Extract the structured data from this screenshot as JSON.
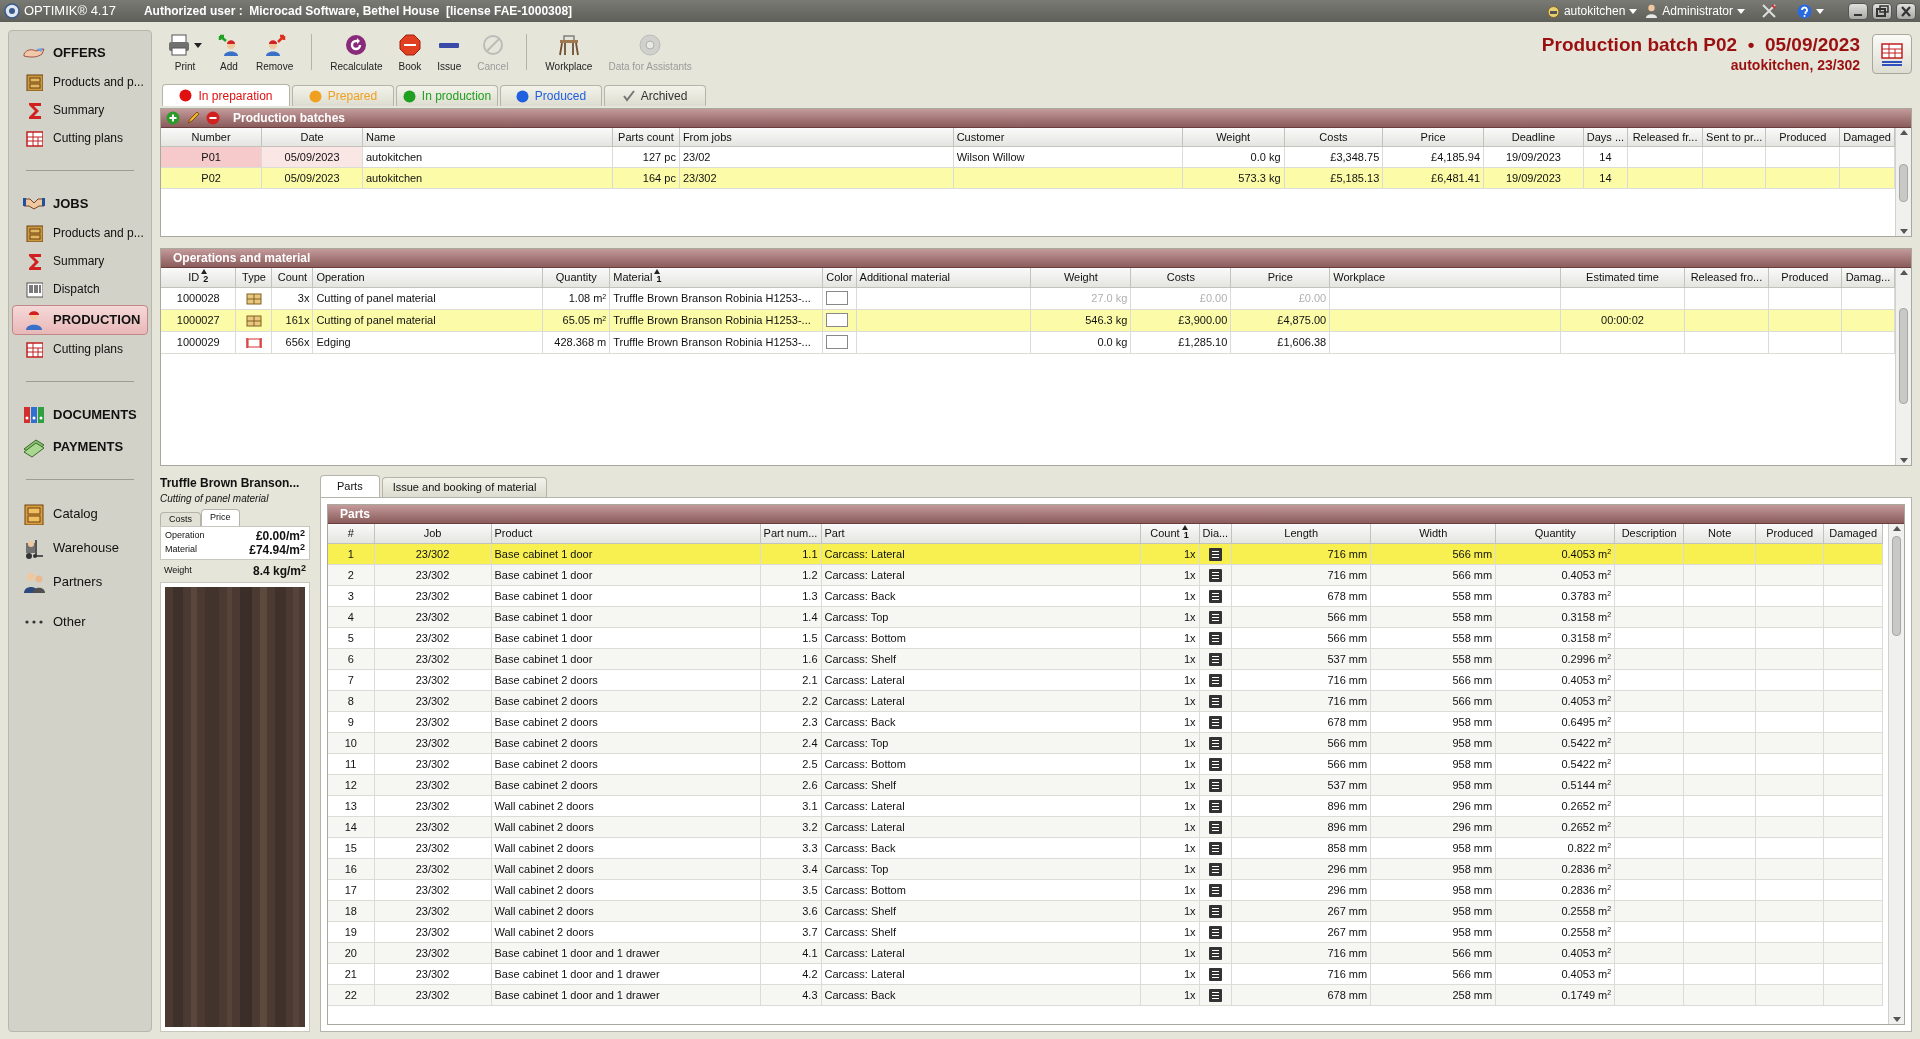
{
  "title_bar": {
    "app": "OPTIMIK® 4.17",
    "authorized": "Authorized user :  Microcad Software, Bethel House  [license FAE-1000308]",
    "company": "autokitchen",
    "user": "Administrator"
  },
  "sidebar": {
    "groups": [
      [
        {
          "label": "OFFERS",
          "kind": "section",
          "selected": false
        },
        {
          "label": "Products and p...",
          "kind": "item",
          "selected": false
        },
        {
          "label": "Summary",
          "kind": "item",
          "selected": false
        },
        {
          "label": "Cutting plans",
          "kind": "item",
          "selected": false
        }
      ],
      [
        {
          "label": "JOBS",
          "kind": "section",
          "selected": false
        },
        {
          "label": "Products and p...",
          "kind": "item",
          "selected": false
        },
        {
          "label": "Summary",
          "kind": "item",
          "selected": false
        },
        {
          "label": "Dispatch",
          "kind": "item",
          "selected": false
        },
        {
          "label": "PRODUCTION",
          "kind": "section",
          "selected": true
        },
        {
          "label": "Cutting plans",
          "kind": "item",
          "selected": false
        }
      ],
      [
        {
          "label": "DOCUMENTS",
          "kind": "section",
          "selected": false
        },
        {
          "label": "PAYMENTS",
          "kind": "section",
          "selected": false
        }
      ],
      [
        {
          "label": "Catalog",
          "kind": "tool",
          "selected": false
        },
        {
          "label": "Warehouse",
          "kind": "tool",
          "selected": false
        },
        {
          "label": "Partners",
          "kind": "tool",
          "selected": false
        },
        {
          "label": "Other",
          "kind": "tool",
          "selected": false
        }
      ]
    ]
  },
  "toolbar": [
    [
      {
        "label": "Print",
        "disabled": false
      },
      {
        "label": "Add",
        "disabled": false
      },
      {
        "label": "Remove",
        "disabled": false
      }
    ],
    [
      {
        "label": "Recalculate",
        "disabled": false
      },
      {
        "label": "Book",
        "disabled": false
      },
      {
        "label": "Issue",
        "disabled": false
      },
      {
        "label": "Cancel",
        "disabled": true
      }
    ],
    [
      {
        "label": "Workplace",
        "disabled": false
      },
      {
        "label": "Data for Assistants",
        "disabled": true
      }
    ]
  ],
  "status_tabs": [
    {
      "label": "In preparation",
      "kind": "dot",
      "color": "#e01010",
      "selected": true
    },
    {
      "label": "Prepared",
      "kind": "dot",
      "color": "#f0a020",
      "selected": false
    },
    {
      "label": "In production",
      "kind": "dot",
      "color": "#20a020",
      "selected": false
    },
    {
      "label": "Produced",
      "kind": "dot",
      "color": "#2060e0",
      "selected": false
    },
    {
      "label": "Archived",
      "kind": "check",
      "color": "#333333",
      "selected": false
    }
  ],
  "header": {
    "title": "Production batch P02  •  05/09/2023",
    "subtitle": "autokitchen, 23/302"
  },
  "batches": {
    "title": "Production batches",
    "columns": [
      {
        "label": "Number"
      },
      {
        "label": "Date"
      },
      {
        "label": "Name"
      },
      {
        "label": "Parts count"
      },
      {
        "label": "From jobs"
      },
      {
        "label": "Customer"
      },
      {
        "label": "Weight"
      },
      {
        "label": "Costs"
      },
      {
        "label": "Price"
      },
      {
        "label": "Deadline"
      },
      {
        "label": "Days ..."
      },
      {
        "label": "Released fr..."
      },
      {
        "label": "Sent to pr..."
      },
      {
        "label": "Produced"
      },
      {
        "label": "Damaged"
      }
    ],
    "rows": [
      {
        "selected": false,
        "marked": true,
        "cells": [
          "P01",
          "05/09/2023",
          "autokitchen",
          "127 pc",
          "23/02",
          "Wilson Willow",
          "0.0 kg",
          "£3,348.75",
          "£4,185.94",
          "19/09/2023",
          "14"
        ]
      },
      {
        "selected": true,
        "marked": false,
        "cells": [
          "P02",
          "05/09/2023",
          "autokitchen",
          "164 pc",
          "23/302",
          "",
          "573.3 kg",
          "£5,185.13",
          "£6,481.41",
          "19/09/2023",
          "14"
        ]
      }
    ]
  },
  "operations": {
    "title": "Operations and material",
    "columns": [
      {
        "label": "ID",
        "sort": "2"
      },
      {
        "label": "Type"
      },
      {
        "label": "Count"
      },
      {
        "label": "Operation"
      },
      {
        "label": "Quantity"
      },
      {
        "label": "Material",
        "sort": "1"
      },
      {
        "label": "Color"
      },
      {
        "label": "Additional material"
      },
      {
        "label": "Weight"
      },
      {
        "label": "Costs"
      },
      {
        "label": "Price"
      },
      {
        "label": "Workplace"
      },
      {
        "label": "Estimated time"
      },
      {
        "label": "Released fro..."
      },
      {
        "label": "Produced"
      },
      {
        "label": "Damag..."
      }
    ],
    "rows": [
      {
        "selected": false,
        "dimmed": true,
        "kind": "panel",
        "cells": [
          "1000028",
          "",
          "3x",
          "Cutting of panel material",
          "1.08 m$^{2}$",
          "Truffle Brown Branson Robinia H1253-...",
          "",
          "",
          "27.0 kg",
          "£0.00",
          "£0.00",
          "",
          ""
        ]
      },
      {
        "selected": true,
        "dimmed": false,
        "kind": "panel",
        "cells": [
          "1000027",
          "",
          "161x",
          "Cutting of panel material",
          "65.05 m$^{2}$",
          "Truffle Brown Branson Robinia H1253-...",
          "",
          "",
          "546.3 kg",
          "£3,900.00",
          "£4,875.00",
          "",
          "00:00:02"
        ]
      },
      {
        "selected": false,
        "dimmed": false,
        "kind": "edge",
        "cells": [
          "1000029",
          "",
          "656x",
          "Edging",
          "428.368 m",
          "Truffle Brown Branson Robinia H1253-...",
          "",
          "",
          "0.0 kg",
          "£1,285.10",
          "£1,606.38",
          "",
          ""
        ]
      }
    ]
  },
  "material": {
    "title": "Truffle Brown Branson...",
    "subtitle": "Cutting of panel material",
    "tabs": [
      {
        "label": "Costs",
        "selected": false
      },
      {
        "label": "Price",
        "selected": true
      }
    ],
    "prices": [
      {
        "label": "Operation",
        "value": "£0.00/m$^{2}$"
      },
      {
        "label": "Material",
        "value": "£74.94/m$^{2}$"
      }
    ],
    "weight": {
      "label": "Weight",
      "value": "8.4 kg/m$^{2}$"
    }
  },
  "detail_tabs": [
    {
      "label": "Parts",
      "selected": true
    },
    {
      "label": "Issue and booking of material",
      "selected": false
    }
  ],
  "parts": {
    "title": "Parts",
    "columns": [
      {
        "label": "#"
      },
      {
        "label": "Job"
      },
      {
        "label": "Product"
      },
      {
        "label": "Part num..."
      },
      {
        "label": "Part"
      },
      {
        "label": "Count",
        "sort": "1"
      },
      {
        "label": "Dia..."
      },
      {
        "label": "Length"
      },
      {
        "label": "Width"
      },
      {
        "label": "Quantity"
      },
      {
        "label": "Description"
      },
      {
        "label": "Note"
      },
      {
        "label": "Produced"
      },
      {
        "label": "Damaged"
      }
    ],
    "rows": [
      {
        "selected": true,
        "cells": [
          "1",
          "23/302",
          "Base cabinet 1 door",
          "1.1",
          "Carcass: Lateral",
          "1x",
          "",
          "716 mm",
          "566 mm",
          "0.4053 m$^{2}$"
        ]
      },
      {
        "selected": false,
        "cells": [
          "2",
          "23/302",
          "Base cabinet 1 door",
          "1.2",
          "Carcass: Lateral",
          "1x",
          "",
          "716 mm",
          "566 mm",
          "0.4053 m$^{2}$"
        ]
      },
      {
        "selected": false,
        "cells": [
          "3",
          "23/302",
          "Base cabinet 1 door",
          "1.3",
          "Carcass: Back",
          "1x",
          "",
          "678 mm",
          "558 mm",
          "0.3783 m$^{2}$"
        ]
      },
      {
        "selected": false,
        "cells": [
          "4",
          "23/302",
          "Base cabinet 1 door",
          "1.4",
          "Carcass: Top",
          "1x",
          "",
          "566 mm",
          "558 mm",
          "0.3158 m$^{2}$"
        ]
      },
      {
        "selected": false,
        "cells": [
          "5",
          "23/302",
          "Base cabinet 1 door",
          "1.5",
          "Carcass: Bottom",
          "1x",
          "",
          "566 mm",
          "558 mm",
          "0.3158 m$^{2}$"
        ]
      },
      {
        "selected": false,
        "cells": [
          "6",
          "23/302",
          "Base cabinet 1 door",
          "1.6",
          "Carcass: Shelf",
          "1x",
          "",
          "537 mm",
          "558 mm",
          "0.2996 m$^{2}$"
        ]
      },
      {
        "selected": false,
        "cells": [
          "7",
          "23/302",
          "Base cabinet 2 doors",
          "2.1",
          "Carcass: Lateral",
          "1x",
          "",
          "716 mm",
          "566 mm",
          "0.4053 m$^{2}$"
        ]
      },
      {
        "selected": false,
        "cells": [
          "8",
          "23/302",
          "Base cabinet 2 doors",
          "2.2",
          "Carcass: Lateral",
          "1x",
          "",
          "716 mm",
          "566 mm",
          "0.4053 m$^{2}$"
        ]
      },
      {
        "selected": false,
        "cells": [
          "9",
          "23/302",
          "Base cabinet 2 doors",
          "2.3",
          "Carcass: Back",
          "1x",
          "",
          "678 mm",
          "958 mm",
          "0.6495 m$^{2}$"
        ]
      },
      {
        "selected": false,
        "cells": [
          "10",
          "23/302",
          "Base cabinet 2 doors",
          "2.4",
          "Carcass: Top",
          "1x",
          "",
          "566 mm",
          "958 mm",
          "0.5422 m$^{2}$"
        ]
      },
      {
        "selected": false,
        "cells": [
          "11",
          "23/302",
          "Base cabinet 2 doors",
          "2.5",
          "Carcass: Bottom",
          "1x",
          "",
          "566 mm",
          "958 mm",
          "0.5422 m$^{2}$"
        ]
      },
      {
        "selected": false,
        "cells": [
          "12",
          "23/302",
          "Base cabinet 2 doors",
          "2.6",
          "Carcass: Shelf",
          "1x",
          "",
          "537 mm",
          "958 mm",
          "0.5144 m$^{2}$"
        ]
      },
      {
        "selected": false,
        "cells": [
          "13",
          "23/302",
          "Wall cabinet 2 doors",
          "3.1",
          "Carcass: Lateral",
          "1x",
          "",
          "896 mm",
          "296 mm",
          "0.2652 m$^{2}$"
        ]
      },
      {
        "selected": false,
        "cells": [
          "14",
          "23/302",
          "Wall cabinet 2 doors",
          "3.2",
          "Carcass: Lateral",
          "1x",
          "",
          "896 mm",
          "296 mm",
          "0.2652 m$^{2}$"
        ]
      },
      {
        "selected": false,
        "cells": [
          "15",
          "23/302",
          "Wall cabinet 2 doors",
          "3.3",
          "Carcass: Back",
          "1x",
          "",
          "858 mm",
          "958 mm",
          "0.822 m$^{2}$"
        ]
      },
      {
        "selected": false,
        "cells": [
          "16",
          "23/302",
          "Wall cabinet 2 doors",
          "3.4",
          "Carcass: Top",
          "1x",
          "",
          "296 mm",
          "958 mm",
          "0.2836 m$^{2}$"
        ]
      },
      {
        "selected": false,
        "cells": [
          "17",
          "23/302",
          "Wall cabinet 2 doors",
          "3.5",
          "Carcass: Bottom",
          "1x",
          "",
          "296 mm",
          "958 mm",
          "0.2836 m$^{2}$"
        ]
      },
      {
        "selected": false,
        "cells": [
          "18",
          "23/302",
          "Wall cabinet 2 doors",
          "3.6",
          "Carcass: Shelf",
          "1x",
          "",
          "267 mm",
          "958 mm",
          "0.2558 m$^{2}$"
        ]
      },
      {
        "selected": false,
        "cells": [
          "19",
          "23/302",
          "Wall cabinet 2 doors",
          "3.7",
          "Carcass: Shelf",
          "1x",
          "",
          "267 mm",
          "958 mm",
          "0.2558 m$^{2}$"
        ]
      },
      {
        "selected": false,
        "cells": [
          "20",
          "23/302",
          "Base cabinet 1 door and 1 drawer",
          "4.1",
          "Carcass: Lateral",
          "1x",
          "",
          "716 mm",
          "566 mm",
          "0.4053 m$^{2}$"
        ]
      },
      {
        "selected": false,
        "cells": [
          "21",
          "23/302",
          "Base cabinet 1 door and 1 drawer",
          "4.2",
          "Carcass: Lateral",
          "1x",
          "",
          "716 mm",
          "566 mm",
          "0.4053 m$^{2}$"
        ]
      },
      {
        "selected": false,
        "cells": [
          "22",
          "23/302",
          "Base cabinet 1 door and 1 drawer",
          "4.3",
          "Carcass: Back",
          "1x",
          "",
          "678 mm",
          "258 mm",
          "0.1749 m$^{2}$"
        ]
      }
    ]
  }
}
